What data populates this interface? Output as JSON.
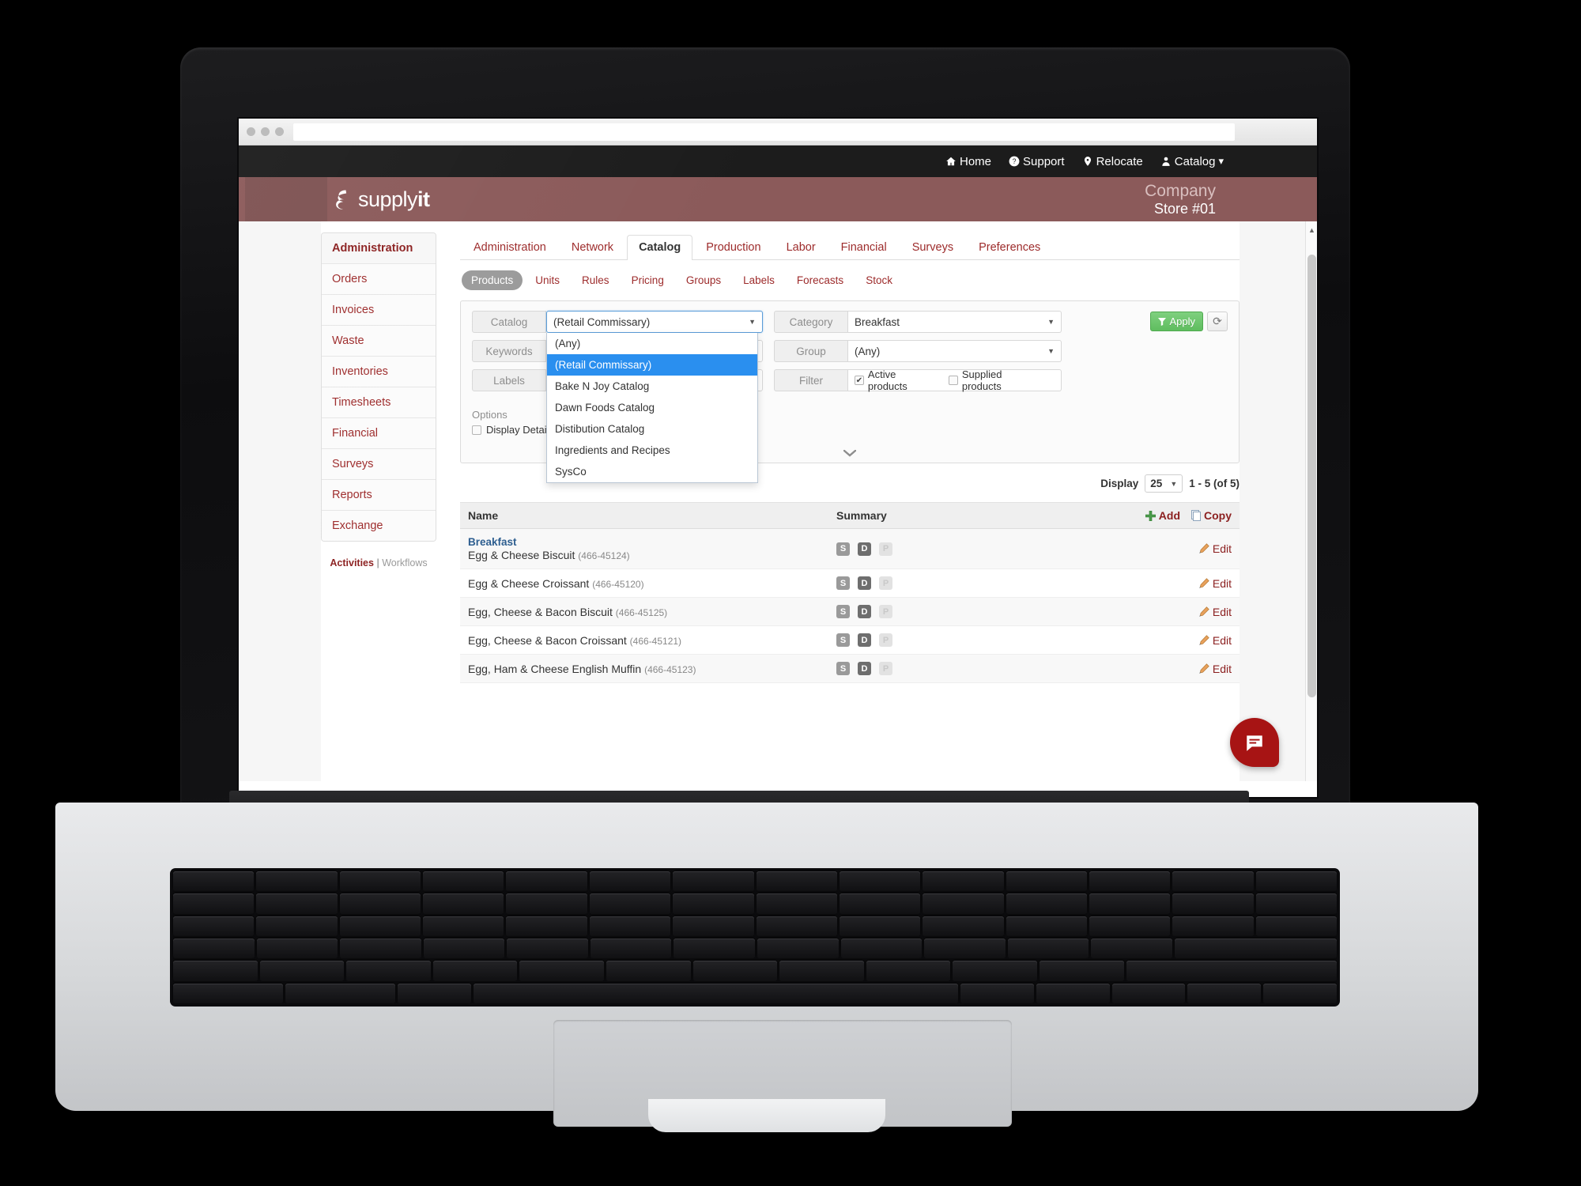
{
  "browser": {
    "url_value": ""
  },
  "topnav": {
    "items": [
      {
        "label": "Home",
        "icon": "home-icon"
      },
      {
        "label": "Support",
        "icon": "question-circle-icon"
      },
      {
        "label": "Relocate",
        "icon": "map-pin-icon"
      },
      {
        "label": "Catalog",
        "icon": "user-icon"
      }
    ],
    "chevron": "▾"
  },
  "brand": {
    "logo_light": "supply",
    "logo_bold": "it",
    "company_name": "Company",
    "store": "Store #01",
    "color": "#8b5a5a"
  },
  "sidebar": {
    "items": [
      {
        "label": "Administration",
        "active": true
      },
      {
        "label": "Orders",
        "active": false
      },
      {
        "label": "Invoices",
        "active": false
      },
      {
        "label": "Waste",
        "active": false
      },
      {
        "label": "Inventories",
        "active": false
      },
      {
        "label": "Timesheets",
        "active": false
      },
      {
        "label": "Financial",
        "active": false
      },
      {
        "label": "Surveys",
        "active": false
      },
      {
        "label": "Reports",
        "active": false
      },
      {
        "label": "Exchange",
        "active": false
      }
    ],
    "footer_links": {
      "activities": "Activities",
      "separator": "|",
      "workflows": "Workflows"
    }
  },
  "tabs_primary": [
    {
      "label": "Administration",
      "active": false
    },
    {
      "label": "Network",
      "active": false
    },
    {
      "label": "Catalog",
      "active": true
    },
    {
      "label": "Production",
      "active": false
    },
    {
      "label": "Labor",
      "active": false
    },
    {
      "label": "Financial",
      "active": false
    },
    {
      "label": "Surveys",
      "active": false
    },
    {
      "label": "Preferences",
      "active": false
    }
  ],
  "tabs_secondary": [
    {
      "label": "Products",
      "active": true
    },
    {
      "label": "Units",
      "active": false
    },
    {
      "label": "Rules",
      "active": false
    },
    {
      "label": "Pricing",
      "active": false
    },
    {
      "label": "Groups",
      "active": false
    },
    {
      "label": "Labels",
      "active": false
    },
    {
      "label": "Forecasts",
      "active": false
    },
    {
      "label": "Stock",
      "active": false
    }
  ],
  "filters": {
    "catalog": {
      "label": "Catalog",
      "value": "(Retail Commissary)"
    },
    "keywords": {
      "label": "Keywords",
      "value": ""
    },
    "labels": {
      "label": "Labels",
      "value": ""
    },
    "category": {
      "label": "Category",
      "value": "Breakfast"
    },
    "group": {
      "label": "Group",
      "value": "(Any)"
    },
    "filter": {
      "label": "Filter",
      "active_products": {
        "label": "Active products",
        "checked": true,
        "mark": "✔"
      },
      "supplied_products": {
        "label": "Supplied products",
        "checked": false,
        "mark": ""
      }
    },
    "apply_button": {
      "label": "Apply",
      "icon": "funnel-icon",
      "color": "#5fbd5f"
    },
    "refresh_button": {
      "icon": "refresh-icon",
      "glyph": "⟳"
    },
    "options": {
      "title": "Options",
      "display_detail": {
        "label": "Display Detail",
        "checked": false
      }
    },
    "collapse_chevron": "⌄"
  },
  "catalog_dropdown": {
    "open": true,
    "options": [
      {
        "label": "(Any)",
        "selected": false
      },
      {
        "label": "(Retail Commissary)",
        "selected": true
      },
      {
        "label": "Bake N Joy Catalog",
        "selected": false
      },
      {
        "label": "Dawn Foods Catalog",
        "selected": false
      },
      {
        "label": "Distibution Catalog",
        "selected": false
      },
      {
        "label": "Ingredients and Recipes",
        "selected": false
      },
      {
        "label": "SysCo",
        "selected": false
      }
    ],
    "highlight_color": "#2a8fef"
  },
  "results": {
    "display_label": "Display",
    "page_size": "25",
    "range_text": "1 - 5 (of 5)",
    "columns": {
      "name": "Name",
      "summary": "Summary"
    },
    "header_actions": [
      {
        "label": "Add",
        "icon": "plus-icon"
      },
      {
        "label": "Copy",
        "icon": "copy-icon"
      }
    ],
    "edit_label": "Edit",
    "edit_icon": "pencil-icon",
    "rows": [
      {
        "category": "Breakfast",
        "name": "Egg & Cheese Biscuit",
        "sku": "(466-45124)",
        "badges": [
          {
            "letter": "S",
            "state": "on"
          },
          {
            "letter": "D",
            "state": "dark"
          },
          {
            "letter": "P",
            "state": "off"
          }
        ]
      },
      {
        "category": "",
        "name": "Egg & Cheese Croissant",
        "sku": "(466-45120)",
        "badges": [
          {
            "letter": "S",
            "state": "on"
          },
          {
            "letter": "D",
            "state": "dark"
          },
          {
            "letter": "P",
            "state": "off"
          }
        ]
      },
      {
        "category": "",
        "name": "Egg, Cheese & Bacon Biscuit",
        "sku": "(466-45125)",
        "badges": [
          {
            "letter": "S",
            "state": "on"
          },
          {
            "letter": "D",
            "state": "dark"
          },
          {
            "letter": "P",
            "state": "off"
          }
        ]
      },
      {
        "category": "",
        "name": "Egg, Cheese & Bacon Croissant",
        "sku": "(466-45121)",
        "badges": [
          {
            "letter": "S",
            "state": "on"
          },
          {
            "letter": "D",
            "state": "dark"
          },
          {
            "letter": "P",
            "state": "off"
          }
        ]
      },
      {
        "category": "",
        "name": "Egg, Ham & Cheese English Muffin",
        "sku": "(466-45123)",
        "badges": [
          {
            "letter": "S",
            "state": "on"
          },
          {
            "letter": "D",
            "state": "dark"
          },
          {
            "letter": "P",
            "state": "off"
          }
        ]
      }
    ]
  },
  "chat_widget": {
    "icon": "chat-bubble-icon",
    "color": "#a71414"
  }
}
